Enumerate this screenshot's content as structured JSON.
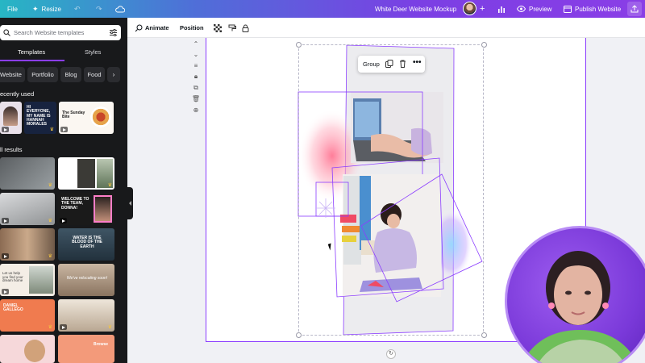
{
  "topbar": {
    "file_label": "File",
    "resize_label": "Resize",
    "doc_title": "White Deer Website Mockup",
    "preview_label": "Preview",
    "publish_label": "Publish Website"
  },
  "panel": {
    "search_placeholder": "Search Website templates",
    "tabs": [
      "Templates",
      "Styles"
    ],
    "chips": [
      "Website",
      "Portfolio",
      "Blog",
      "Food"
    ],
    "recently_used_label": "ecently used",
    "all_results_label": "ll results",
    "thumbs": {
      "hi_everyone": "HI EVERYONE, MY NAME IS HANNAH MORALES",
      "sunday_bite": "The Sunday Bite",
      "welcome": "WELCOME TO THE TEAM, DONNA!",
      "water": "WATER IS THE BLOOD OF THE EARTH",
      "lets_help": "Let us help you find your dream home",
      "were_relocating": "We've relocating soon!",
      "daniel": "DANIEL GALLEGO",
      "browse": "Browse"
    }
  },
  "toolbar": {
    "animate_label": "Animate",
    "position_label": "Position"
  },
  "canvas": {
    "group_label": "Group"
  },
  "colors": {
    "accent": "#8b3dff",
    "panel_bg": "#18191b",
    "canvas_bg": "#f0f1f5"
  }
}
